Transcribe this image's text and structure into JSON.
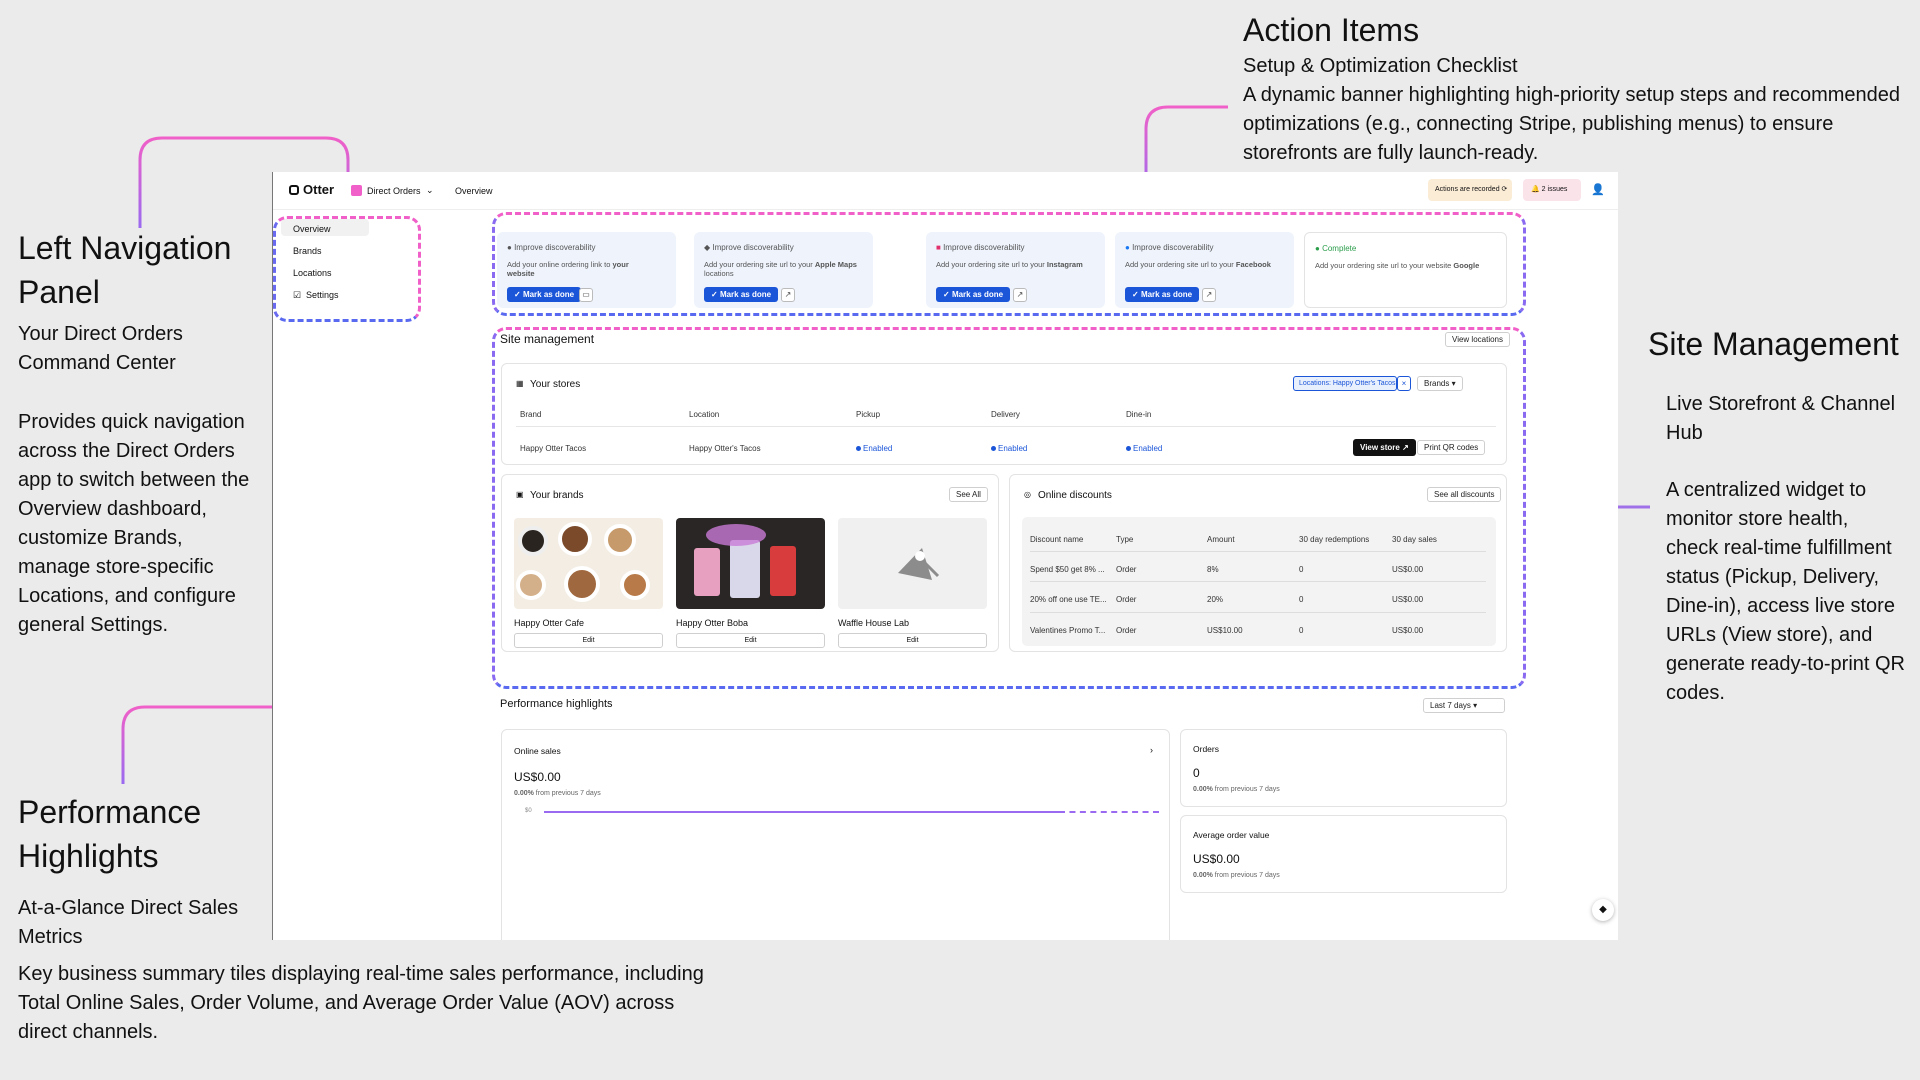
{
  "annotations": {
    "left_nav": {
      "title": "Left Navigation Panel",
      "subtitle": "Your Direct Orders Command Center",
      "body": "Provides quick navigation across the Direct Orders app to switch between the Overview dashboard, customize Brands, manage store-specific Locations, and configure general Settings."
    },
    "action_items": {
      "title": "Action Items",
      "subtitle": "Setup & Optimization Checklist",
      "body": "A dynamic banner highlighting high-priority setup steps and recommended optimizations (e.g., connecting Stripe, publishing menus) to ensure storefronts are fully launch-ready."
    },
    "site_mgmt": {
      "title": "Site Management",
      "subtitle": "Live Storefront & Channel Hub",
      "body": "A centralized widget to monitor store health, check real-time fulfillment status (Pickup, Delivery, Dine-in), access live store URLs (View store), and generate ready-to-print QR codes."
    },
    "performance": {
      "title": "Performance Highlights",
      "subtitle": "At-a-Glance Direct Sales Metrics",
      "body": "Key business summary tiles displaying real-time sales performance, including Total Online Sales, Order Volume, and Average Order Value (AOV) across direct channels."
    }
  },
  "topbar": {
    "logo": "Otter",
    "app_name": "Direct Orders",
    "crumb": "Overview",
    "recording": "Actions are recorded",
    "issues": "2 issues"
  },
  "sidebar": {
    "items": [
      "Overview",
      "Brands",
      "Locations",
      "Settings"
    ]
  },
  "action_cards": [
    {
      "heading": "Improve discoverability",
      "text_a": "Add your online ordering link to ",
      "text_b": "your website",
      "button": "Mark as done"
    },
    {
      "heading": "Improve discoverability",
      "text_a": "Add your ordering site url to your ",
      "text_b": "Apple Maps",
      "text_c": " locations",
      "button": "Mark as done"
    },
    {
      "heading": "Improve discoverability",
      "text_a": "Add your ordering site url to your ",
      "text_b": "Instagram",
      "button": "Mark as done"
    },
    {
      "heading": "Improve discoverability",
      "text_a": "Add your ordering site url to your ",
      "text_b": "Facebook",
      "button": "Mark as done"
    },
    {
      "heading": "Complete",
      "text_a": "Add your ordering site url to your website ",
      "text_b": "Google"
    }
  ],
  "site_management": {
    "title": "Site management",
    "view_locations": "View locations",
    "stores": {
      "title": "Your stores",
      "filter": "Locations: Happy Otter's Tacos",
      "brands": "Brands",
      "headers": [
        "Brand",
        "Location",
        "Pickup",
        "Delivery",
        "Dine-in"
      ],
      "row": {
        "brand": "Happy Otter Tacos",
        "location": "Happy Otter's Tacos",
        "pickup": "Enabled",
        "delivery": "Enabled",
        "dinein": "Enabled"
      },
      "view_store": "View store",
      "print_qr": "Print QR codes"
    },
    "brands": {
      "title": "Your brands",
      "see_all": "See All",
      "items": [
        {
          "name": "Happy Otter Cafe",
          "edit": "Edit"
        },
        {
          "name": "Happy Otter Boba",
          "edit": "Edit"
        },
        {
          "name": "Waffle House Lab",
          "edit": "Edit"
        }
      ]
    },
    "discounts": {
      "title": "Online discounts",
      "see_all": "See all discounts",
      "headers": [
        "Discount name",
        "Type",
        "Amount",
        "30 day redemptions",
        "30 day sales"
      ],
      "rows": [
        [
          "Spend $50 get 8% ...",
          "Order",
          "8%",
          "0",
          "US$0.00"
        ],
        [
          "20% off one use TE...",
          "Order",
          "20%",
          "0",
          "US$0.00"
        ],
        [
          "Valentines Promo T...",
          "Order",
          "US$10.00",
          "0",
          "US$0.00"
        ]
      ]
    }
  },
  "performance": {
    "title": "Performance highlights",
    "range": "Last 7 days",
    "online_sales": {
      "label": "Online sales",
      "value": "US$0.00",
      "pct": "0.00%",
      "note": " from previous 7 days",
      "axis": "$0"
    },
    "orders": {
      "label": "Orders",
      "value": "0",
      "pct": "0.00%",
      "note": " from previous 7 days"
    },
    "aov": {
      "label": "Average order value",
      "value": "US$0.00",
      "pct": "0.00%",
      "note": " from previous 7 days"
    }
  },
  "colors": {
    "pink": "#f060c8",
    "blue": "#5a6af0",
    "accent": "#1b55d8"
  }
}
